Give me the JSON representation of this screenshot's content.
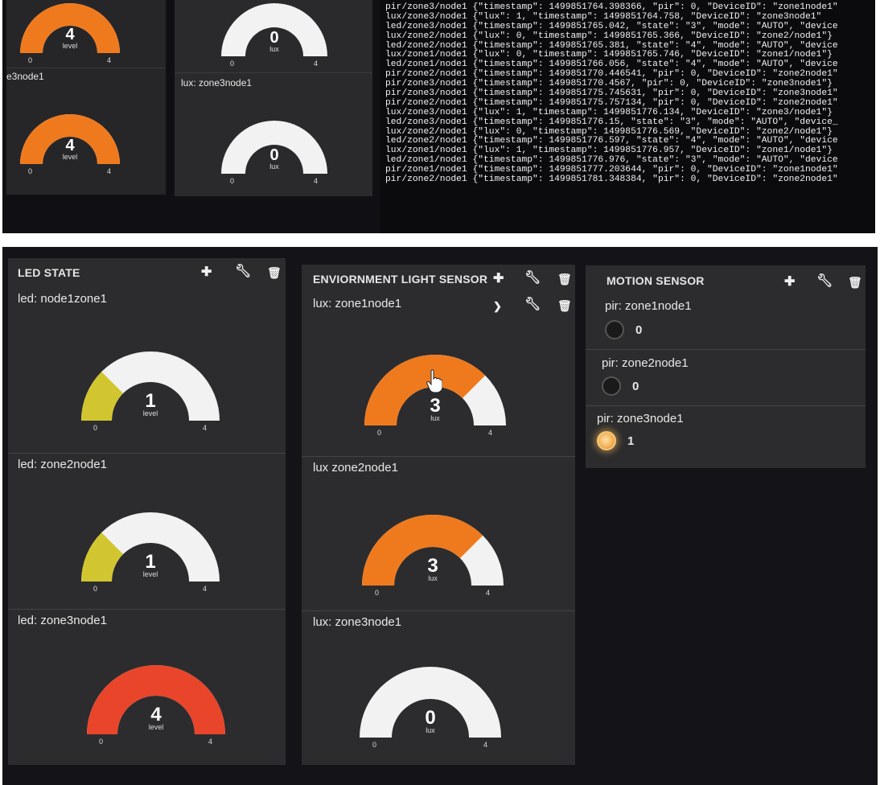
{
  "top_photo": {
    "left_panel_label": "e3node1",
    "middle_panel_label": "lux: zone3node1",
    "gauges": [
      {
        "value": "4",
        "unit": "level",
        "min": "0",
        "max": "4",
        "fraction": 1.0,
        "color": "#ef7a1e"
      },
      {
        "value": "0",
        "unit": "lux",
        "min": "0",
        "max": "4",
        "fraction": 0.0,
        "color": "#ef7a1e"
      },
      {
        "value": "4",
        "unit": "level",
        "min": "0",
        "max": "4",
        "fraction": 1.0,
        "color": "#ef7a1e"
      },
      {
        "value": "0",
        "unit": "lux",
        "min": "0",
        "max": "4",
        "fraction": 0.0,
        "color": "#ef7a1e"
      }
    ],
    "console_lines": [
      "pir/zone3/node1 {\"timestamp\": 1499851764.398366, \"pir\": 0, \"DeviceID\": \"zone1node1\"",
      "lux/zone3/node1 {\"lux\": 1, \"timestamp\": 1499851764.758, \"DeviceID\": \"zone3node1\"",
      "led/zone3/node1 {\"timestamp\": 1499851765.042, \"state\": \"3\", \"mode\": \"AUTO\", \"device",
      "lux/zone2/node1 {\"lux\": 0, \"timestamp\": 1499851765.366, \"DeviceID\": \"zone2/node1\"}",
      "led/zone2/node1 {\"timestamp\": 1499851765.381, \"state\": \"4\", \"mode\": \"AUTO\", \"device",
      "lux/zone1/node1 {\"lux\": 0, \"timestamp\": 1499851765.746, \"DeviceID\": \"zone1/node1\"}",
      "led/zone1/node1 {\"timestamp\": 1499851766.056, \"state\": \"4\", \"mode\": \"AUTO\", \"device",
      "pir/zone2/node1 {\"timestamp\": 1499851770.446541, \"pir\": 0, \"DeviceID\": \"zone2node1\"",
      "pir/zone3/node1 {\"timestamp\": 1499851770.4567, \"pir\": 0, \"DeviceID\": \"zone3node1\"}",
      "pir/zone3/node1 {\"timestamp\": 1499851775.745631, \"pir\": 0, \"DeviceID\": \"zone3node1\"",
      "pir/zone2/node1 {\"timestamp\": 1499851775.757134, \"pir\": 0, \"DeviceID\": \"zone2node1\"",
      "lux/zone3/node1 {\"lux\": 1, \"timestamp\": 1499851776.134, \"DeviceID\": \"zone3/node1\"}",
      "led/zone3/node1 {\"timestamp\": 1499851776.15, \"state\": \"3\", \"mode\": \"AUTO\", \"device_",
      "lux/zone2/node1 {\"lux\": 0, \"timestamp\": 1499851776.569, \"DeviceID\": \"zone2/node1\"}",
      "led/zone2/node1 {\"timestamp\": 1499851776.597, \"state\": \"4\", \"mode\": \"AUTO\", \"device",
      "lux/zone1/node1 {\"lux\": 1, \"timestamp\": 1499851776.957, \"DeviceID\": \"zone1/node1\"}",
      "led/zone1/node1 {\"timestamp\": 1499851776.976, \"state\": \"3\", \"mode\": \"AUTO\", \"device",
      "pir/zone1/node1 {\"timestamp\": 1499851777.203644, \"pir\": 0, \"DeviceID\": \"zone1node1\"",
      "pir/zone2/node1 {\"timestamp\": 1499851781.348384, \"pir\": 0, \"DeviceID\": \"zone2node1\""
    ]
  },
  "led_state": {
    "title": "LED STATE",
    "widgets": [
      {
        "label": "led: node1zone1",
        "value": "1",
        "unit": "level",
        "min": "0",
        "max": "4",
        "fraction": 0.25,
        "color": "#d2c630"
      },
      {
        "label": "led: zone2node1",
        "value": "1",
        "unit": "level",
        "min": "0",
        "max": "4",
        "fraction": 0.25,
        "color": "#d2c630"
      },
      {
        "label": "led: zone3node1",
        "value": "4",
        "unit": "level",
        "min": "0",
        "max": "4",
        "fraction": 1.0,
        "color": "#e8452a"
      }
    ]
  },
  "light_sensor": {
    "title": "ENVIORNMENT LIGHT SENSOR",
    "widgets": [
      {
        "label": "lux: zone1node1",
        "value": "3",
        "unit": "lux",
        "min": "0",
        "max": "4",
        "fraction": 0.75,
        "color": "#ef7a1e"
      },
      {
        "label": "lux zone2node1",
        "value": "3",
        "unit": "lux",
        "min": "0",
        "max": "4",
        "fraction": 0.75,
        "color": "#ef7a1e"
      },
      {
        "label": "lux: zone3node1",
        "value": "0",
        "unit": "lux",
        "min": "0",
        "max": "4",
        "fraction": 0.0,
        "color": "#ef7a1e"
      }
    ]
  },
  "motion_sensor": {
    "title": "MOTION SENSOR",
    "widgets": [
      {
        "label": "pir: zone1node1",
        "value": "0",
        "state": "off"
      },
      {
        "label": "pir: zone2node1",
        "value": "0",
        "state": "off"
      },
      {
        "label": "pir: zone3node1",
        "value": "1",
        "state": "on"
      }
    ]
  },
  "icons": {
    "add": "plus-icon",
    "edit": "wrench-icon",
    "delete": "trash-icon",
    "collapse": "chevron-down-icon"
  },
  "colors": {
    "gauge_track": "#f2f2f2",
    "panel_bg": "#2c2c2e",
    "orange": "#ef7a1e",
    "yellow": "#d2c630",
    "red": "#e8452a"
  }
}
